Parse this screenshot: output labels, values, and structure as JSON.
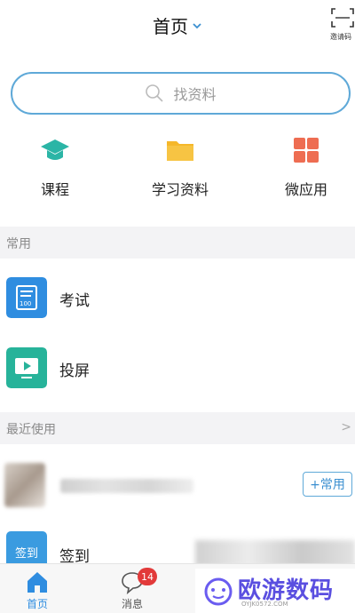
{
  "header": {
    "title": "首页",
    "invite_label": "邀请码"
  },
  "search": {
    "placeholder": "找资料"
  },
  "quick_actions": [
    {
      "label": "课程",
      "icon": "graduation-cap-icon",
      "color": "#2bb5a6"
    },
    {
      "label": "学习资料",
      "icon": "folder-icon",
      "color": "#f5b72a"
    },
    {
      "label": "微应用",
      "icon": "grid-apps-icon",
      "color": "#ee6d52"
    }
  ],
  "section_common": {
    "title": "常用"
  },
  "common_items": [
    {
      "label": "考试",
      "icon": "exam-paper-icon",
      "color": "#2f8de0"
    },
    {
      "label": "投屏",
      "icon": "screen-cast-icon",
      "color": "#27b39a"
    }
  ],
  "section_recent": {
    "title": "最近使用",
    "arrow": ">"
  },
  "recent_items": [
    {
      "action_label": "+常用"
    }
  ],
  "sign_item": {
    "icon_text": "签到",
    "label": "签到",
    "color": "#3a9be0"
  },
  "tabbar": {
    "items": [
      {
        "label": "首页",
        "icon": "home-icon",
        "active": true
      },
      {
        "label": "消息",
        "icon": "chat-bubble-icon",
        "badge": "14"
      }
    ]
  },
  "watermark": {
    "text": "欧游数码",
    "sub": "OYJK0572.COM"
  },
  "colors": {
    "accent": "#3b8fd0",
    "search_border": "#5fa9d8",
    "section_bg": "#f3f3f5",
    "badge": "#e23a3a"
  }
}
